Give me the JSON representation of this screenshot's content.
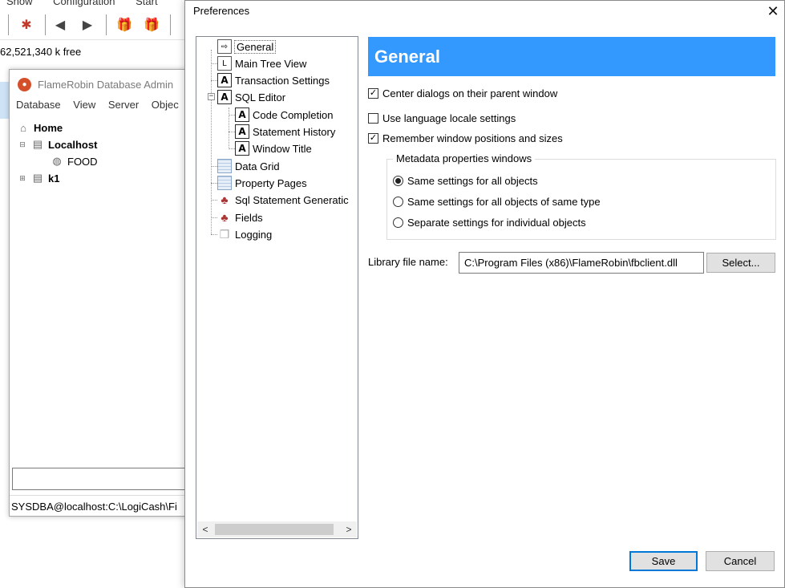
{
  "background_app": {
    "menu": [
      "Show",
      "Configuration",
      "Start"
    ],
    "free_space": "62,521,340 k free",
    "window": {
      "title": "FlameRobin Database Admin",
      "menus": [
        "Database",
        "View",
        "Server",
        "Objec"
      ],
      "tree": {
        "home": "Home",
        "localhost": "Localhost",
        "food": "FOOD",
        "k1": "k1"
      },
      "status": "SYSDBA@localhost:C:\\LogiCash\\Fi"
    }
  },
  "dialog": {
    "title": "Preferences",
    "close_label": "✕",
    "tree": {
      "general": "General",
      "main_tree_view": "Main Tree View",
      "transaction_settings": "Transaction Settings",
      "sql_editor": "SQL Editor",
      "code_completion": "Code Completion",
      "statement_history": "Statement History",
      "window_title": "Window Title",
      "data_grid": "Data Grid",
      "property_pages": "Property Pages",
      "sql_statement_generation": "Sql Statement Generatic",
      "fields": "Fields",
      "logging": "Logging"
    },
    "scroll_left": "<",
    "scroll_right": ">",
    "section_title": "General",
    "options": {
      "center_dialogs": {
        "label": "Center dialogs on their parent window",
        "checked": true
      },
      "language_locale": {
        "label": "Use language locale settings",
        "checked": false
      },
      "remember_positions": {
        "label": "Remember window positions and sizes",
        "checked": true
      }
    },
    "metadata_group": {
      "label": "Metadata properties windows",
      "same_all": "Same settings for all objects",
      "same_type": "Same settings for all objects of same type",
      "separate": "Separate settings for individual objects",
      "selected": "same_all"
    },
    "library": {
      "label": "Library file name:",
      "value": "C:\\Program Files (x86)\\FlameRobin\\fbclient.dll",
      "select_button": "Select..."
    },
    "save_button": "Save",
    "cancel_button": "Cancel"
  }
}
